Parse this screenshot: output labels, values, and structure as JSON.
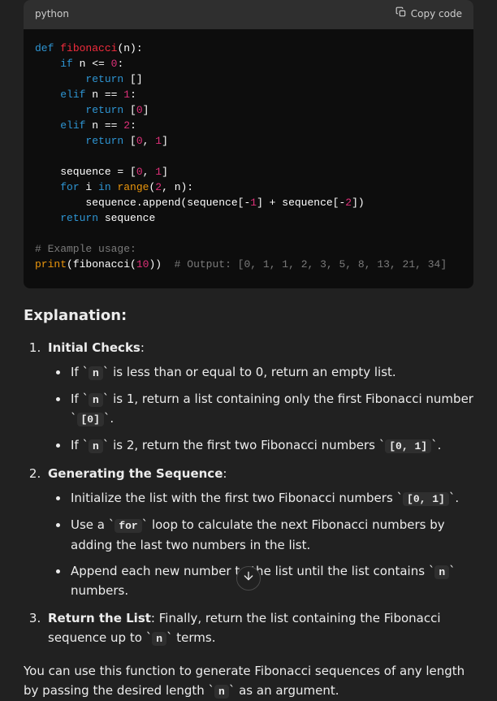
{
  "code": {
    "language": "python",
    "copy_label": "Copy code",
    "source": "def fibonacci(n):\n    if n <= 0:\n        return []\n    elif n == 1:\n        return [0]\n    elif n == 2:\n        return [0, 1]\n\n    sequence = [0, 1]\n    for i in range(2, n):\n        sequence.append(sequence[-1] + sequence[-2])\n    return sequence\n\n# Example usage:\nprint(fibonacci(10))  # Output: [0, 1, 1, 2, 3, 5, 8, 13, 21, 34]"
  },
  "explanation": {
    "heading": "Explanation:",
    "items": [
      {
        "title": "Initial Checks",
        "bullets": [
          {
            "pre": "If ",
            "code": "n",
            "post": " is less than or equal to 0, return an empty list."
          },
          {
            "pre": "If ",
            "code": "n",
            "post": " is 1, return a list containing only the first Fibonacci number ",
            "code2": "[0]",
            "post2": "."
          },
          {
            "pre": "If ",
            "code": "n",
            "post": " is 2, return the first two Fibonacci numbers ",
            "code2": "[0, 1]",
            "post2": "."
          }
        ]
      },
      {
        "title": "Generating the Sequence",
        "bullets": [
          {
            "pre": "Initialize the list with the first two Fibonacci numbers ",
            "code": "[0, 1]",
            "post": "."
          },
          {
            "pre": "Use a ",
            "code": "for",
            "post": " loop to calculate the next Fibonacci numbers by adding the last two numbers in the list."
          },
          {
            "pre": "Append each new number to the list until the list contains ",
            "code": "n",
            "post": " numbers."
          }
        ]
      },
      {
        "title": "Return the List",
        "inline": ": Finally, return the list containing the Fibonacci sequence up to ",
        "code": "n",
        "tail": " terms."
      }
    ],
    "closing_pre": "You can use this function to generate Fibonacci sequences of any length by passing the desired length ",
    "closing_code": "n",
    "closing_post": " as an argument."
  }
}
